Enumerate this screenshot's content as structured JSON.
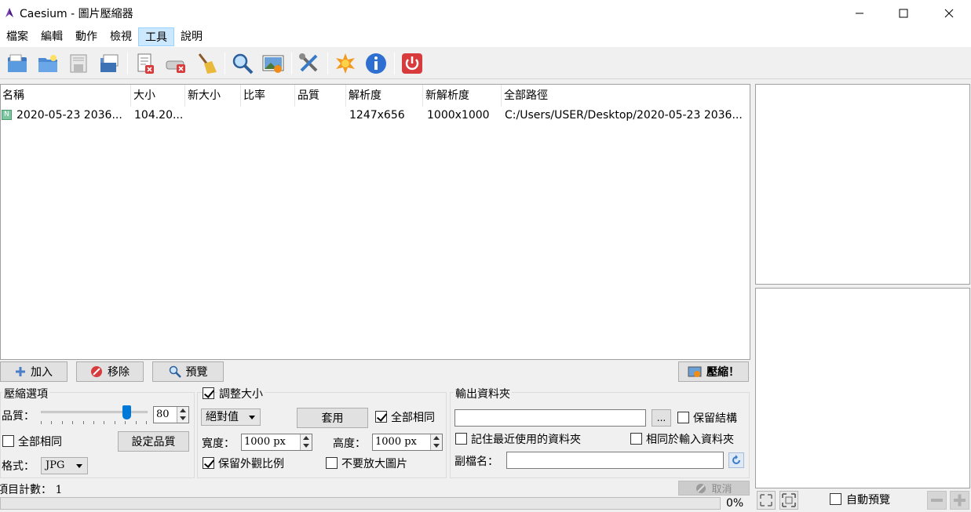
{
  "window": {
    "title": "Caesium - 圖片壓縮器"
  },
  "menu": [
    "檔案",
    "編輯",
    "動作",
    "檢視",
    "工具",
    "說明"
  ],
  "toolbar": {
    "icons": [
      "open-files-icon",
      "open-folder-icon",
      "save-list-icon",
      "save-as-icon",
      "remove-item-icon",
      "clear-list-icon",
      "clean-icon",
      "zoom-icon",
      "preview-image-icon",
      "settings-icon",
      "update-icon",
      "info-icon",
      "exit-icon"
    ]
  },
  "list": {
    "columns": [
      "名稱",
      "大小",
      "新大小",
      "比率",
      "品質",
      "解析度",
      "新解析度",
      "全部路徑"
    ],
    "rows": [
      {
        "badge": "N",
        "name": "2020-05-23 2036...",
        "size": "104.20...",
        "new_size": "",
        "ratio": "",
        "quality": "",
        "resolution": "1247x656",
        "new_resolution": "1000x1000",
        "path": "C:/Users/USER/Desktop/2020-05-23 2036..."
      }
    ]
  },
  "actions": {
    "add": "加入",
    "remove": "移除",
    "preview": "預覽",
    "compress": "壓縮！"
  },
  "compression": {
    "group_title": "壓縮選項",
    "quality_label": "品質：",
    "quality_value": "80",
    "quality_fraction": 0.8,
    "same_for_all": "全部相同",
    "set_quality": "設定品質",
    "format_label": "格式：",
    "format_value": "JPG"
  },
  "resize": {
    "group_title": "調整大小",
    "mode": "絕對值",
    "apply": "套用",
    "same_for_all": "全部相同",
    "width_label": "寬度：",
    "width_value": "1000 px",
    "height_label": "高度：",
    "height_value": "1000 px",
    "keep_ratio": "保留外觀比例",
    "no_enlarge": "不要放大圖片"
  },
  "output": {
    "group_title": "輸出資料夾",
    "browse": "...",
    "keep_structure": "保留結構",
    "remember_last": "記住最近使用的資料夾",
    "same_as_input": "相同於輸入資料夾",
    "suffix_label": "副檔名："
  },
  "status": {
    "item_count_label": "項目計數：",
    "item_count": "1",
    "cancel": "取消",
    "progress": "0%"
  },
  "preview_panel": {
    "auto_preview": "自動預覽"
  },
  "colors": {
    "accent": "#0078d7",
    "red": "#d83b3b",
    "selection": "#cce8ff"
  }
}
